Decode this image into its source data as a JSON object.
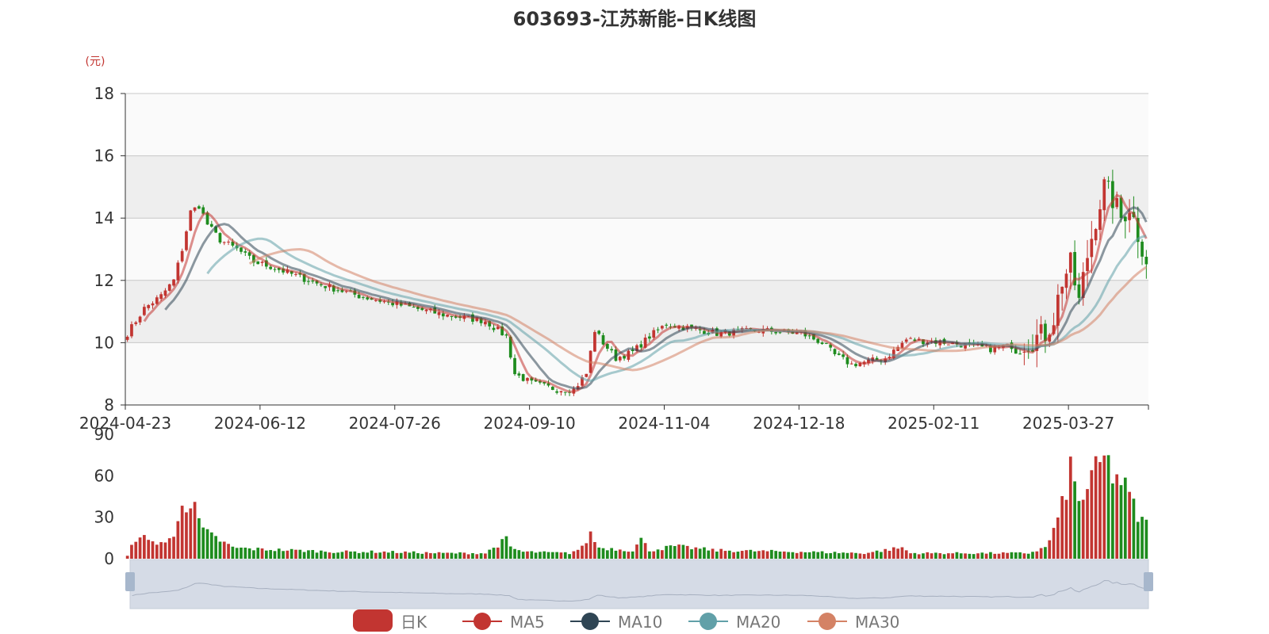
{
  "chart_data": [
    {
      "type": "candlestick",
      "title": "603693-江苏新能-日K线图",
      "ylabel": "(元)",
      "ylim": [
        8,
        18
      ],
      "yticks": [
        "8",
        "10",
        "12",
        "14",
        "16",
        "18"
      ],
      "xticks": [
        "2024-04-23",
        "2024-06-12",
        "2024-07-26",
        "2024-09-10",
        "2024-11-04",
        "2024-12-18",
        "2025-02-11",
        "2025-03-27"
      ],
      "grid": true,
      "legend": [
        "日K",
        "MA5",
        "MA10",
        "MA20",
        "MA30"
      ],
      "legend_position": "bottom",
      "up_color": "#c23531",
      "down_color": "#1e8c1e",
      "ma_colors": {
        "MA5": "#c23531",
        "MA10": "#2f4554",
        "MA20": "#61a0a8",
        "MA30": "#d48265"
      },
      "close_anchors": [
        [
          0,
          10.3
        ],
        [
          4,
          11.1
        ],
        [
          8,
          11.5
        ],
        [
          11,
          12.0
        ],
        [
          13,
          13.0
        ],
        [
          15,
          14.2
        ],
        [
          17,
          14.4
        ],
        [
          19,
          13.8
        ],
        [
          22,
          13.3
        ],
        [
          26,
          13.0
        ],
        [
          30,
          12.6
        ],
        [
          35,
          12.4
        ],
        [
          45,
          11.9
        ],
        [
          55,
          11.5
        ],
        [
          65,
          11.2
        ],
        [
          75,
          10.9
        ],
        [
          85,
          10.7
        ],
        [
          90,
          10.2
        ],
        [
          92,
          9.0
        ],
        [
          96,
          8.7
        ],
        [
          102,
          8.5
        ],
        [
          106,
          8.5
        ],
        [
          109,
          9.0
        ],
        [
          111,
          10.4
        ],
        [
          113,
          10.0
        ],
        [
          116,
          9.5
        ],
        [
          120,
          9.7
        ],
        [
          124,
          10.2
        ],
        [
          128,
          10.6
        ],
        [
          132,
          10.5
        ],
        [
          140,
          10.3
        ],
        [
          150,
          10.4
        ],
        [
          160,
          10.3
        ],
        [
          165,
          10.0
        ],
        [
          168,
          9.6
        ],
        [
          172,
          9.3
        ],
        [
          180,
          9.5
        ],
        [
          185,
          10.1
        ],
        [
          195,
          10.0
        ],
        [
          205,
          9.8
        ],
        [
          210,
          9.9
        ],
        [
          215,
          10.1
        ],
        [
          218,
          10.3
        ],
        [
          220,
          10.8
        ],
        [
          222,
          12.0
        ],
        [
          224,
          12.5
        ],
        [
          226,
          11.3
        ],
        [
          228,
          12.8
        ],
        [
          230,
          14.0
        ],
        [
          232,
          15.0
        ],
        [
          234,
          14.6
        ],
        [
          236,
          14.0
        ],
        [
          238,
          14.4
        ],
        [
          240,
          13.5
        ],
        [
          242,
          12.7
        ]
      ]
    },
    {
      "type": "bar",
      "ylim": [
        0,
        90
      ],
      "yticks": [
        "0",
        "30",
        "60",
        "90"
      ],
      "volume_anchors": [
        [
          0,
          2
        ],
        [
          2,
          15
        ],
        [
          3,
          18
        ],
        [
          5,
          12
        ],
        [
          9,
          12
        ],
        [
          11,
          15
        ],
        [
          12,
          30
        ],
        [
          13,
          46
        ],
        [
          14,
          40
        ],
        [
          16,
          35
        ],
        [
          18,
          20
        ],
        [
          21,
          15
        ],
        [
          25,
          8
        ],
        [
          30,
          7
        ],
        [
          40,
          6
        ],
        [
          50,
          5
        ],
        [
          60,
          5
        ],
        [
          75,
          4
        ],
        [
          85,
          4
        ],
        [
          90,
          14
        ],
        [
          91,
          8
        ],
        [
          94,
          5
        ],
        [
          105,
          4
        ],
        [
          108,
          8
        ],
        [
          110,
          18
        ],
        [
          112,
          8
        ],
        [
          120,
          6
        ],
        [
          122,
          14
        ],
        [
          124,
          6
        ],
        [
          130,
          9
        ],
        [
          140,
          6
        ],
        [
          160,
          5
        ],
        [
          175,
          4
        ],
        [
          184,
          8
        ],
        [
          186,
          4
        ],
        [
          200,
          4
        ],
        [
          214,
          4
        ],
        [
          218,
          8
        ],
        [
          220,
          20
        ],
        [
          222,
          38
        ],
        [
          224,
          65
        ],
        [
          226,
          40
        ],
        [
          228,
          52
        ],
        [
          230,
          62
        ],
        [
          232,
          72
        ],
        [
          234,
          62
        ],
        [
          236,
          56
        ],
        [
          238,
          45
        ],
        [
          240,
          30
        ],
        [
          242,
          25
        ]
      ]
    }
  ],
  "legend": {
    "items": [
      "日K",
      "MA5",
      "MA10",
      "MA20",
      "MA30"
    ]
  }
}
